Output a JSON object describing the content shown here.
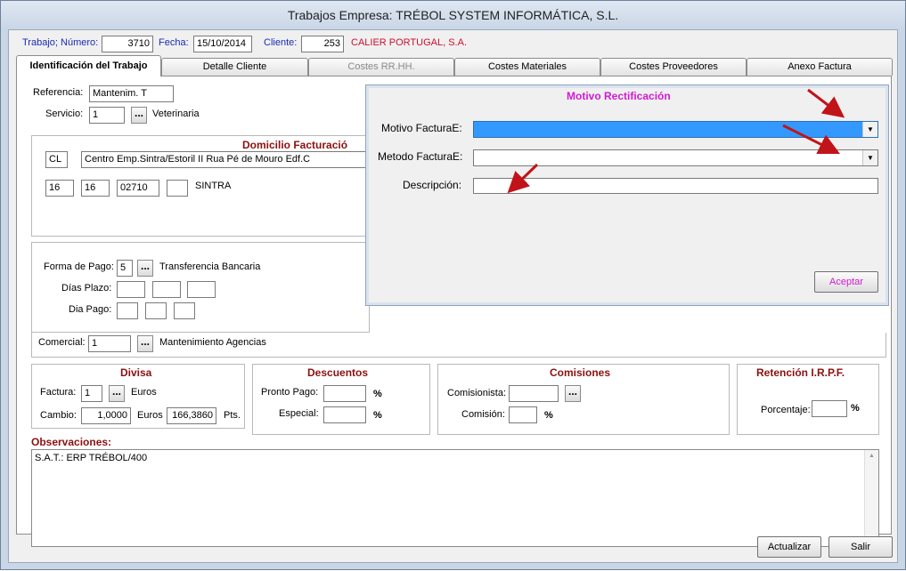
{
  "window": {
    "title": "Trabajos Empresa: TRÉBOL SYSTEM INFORMÁTICA, S.L."
  },
  "header": {
    "trabajo_label": "Trabajo; Número:",
    "trabajo_value": "3710",
    "fecha_label": "Fecha:",
    "fecha_value": "15/10/2014",
    "cliente_label": "Cliente:",
    "cliente_value": "253",
    "cliente_name": "CALIER PORTUGAL, S.A."
  },
  "tabs": [
    {
      "label": "Identificación del Trabajo"
    },
    {
      "label": "Detalle Cliente"
    },
    {
      "label": "Costes RR.HH."
    },
    {
      "label": "Costes Materiales"
    },
    {
      "label": "Costes Proveedores"
    },
    {
      "label": "Anexo Factura"
    }
  ],
  "ident": {
    "referencia_label": "Referencia:",
    "referencia_value": "Mantenim. T",
    "servicio_label": "Servicio:",
    "servicio_value": "1",
    "servicio_name": "Veterinaria",
    "dots": "..."
  },
  "domicilio": {
    "title": "Domicilio Facturació",
    "tipo": "CL",
    "direccion": "Centro Emp.Sintra/Estoril II Rua Pé de Mouro Edf.C",
    "f1": "16",
    "f2": "16",
    "cp": "02710",
    "f4": "",
    "poblacion": "SINTRA"
  },
  "pago": {
    "forma_label": "Forma de Pago:",
    "forma_value": "5",
    "forma_name": "Transferencia Bancaria",
    "dias_plazo_label": "Días Plazo:",
    "dia_pago_label": "Dia Pago:"
  },
  "comercial": {
    "label": "Comercial:",
    "value": "1",
    "name": "Mantenimiento Agencias"
  },
  "divisa": {
    "title": "Divisa",
    "factura_label": "Factura:",
    "factura_value": "1",
    "factura_currency": "Euros",
    "cambio_label": "Cambio:",
    "cambio_value": "1,0000",
    "euros_label": "Euros",
    "pts_value": "166,3860",
    "pts_label": "Pts."
  },
  "descuentos": {
    "title": "Descuentos",
    "pronto_label": "Pronto Pago:",
    "especial_label": "Especial:",
    "pct": "%"
  },
  "comisiones": {
    "title": "Comisiones",
    "comisionista_label": "Comisionista:",
    "comision_label": "Comisión:"
  },
  "retencion": {
    "title": "Retención I.R.P.F.",
    "porcentaje_label": "Porcentaje:"
  },
  "observaciones": {
    "label": "Observaciones:",
    "value": "S.A.T.: ERP TRÉBOL/400"
  },
  "popup": {
    "title": "Motivo Rectificación",
    "motivo_label": "Motivo FacturaE:",
    "metodo_label": "Metodo FacturaE:",
    "descripcion_label": "Descripción:",
    "aceptar_label": "Aceptar"
  },
  "footer": {
    "actualizar_label": "Actualizar",
    "salir_label": "Salir"
  },
  "colors": {
    "popup_title": "#d11ad1",
    "selected_combo": "#3399ff",
    "annotation_arrow": "#c0141a"
  }
}
